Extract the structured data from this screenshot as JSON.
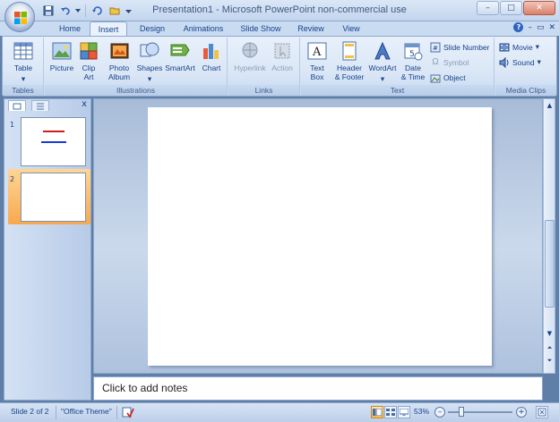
{
  "window": {
    "title": "Presentation1 - Microsoft PowerPoint non-commercial use",
    "controls": [
      "–",
      "□",
      "✕"
    ]
  },
  "tabs": [
    {
      "label": "Home",
      "active": false
    },
    {
      "label": "Insert",
      "active": true
    },
    {
      "label": "Design",
      "active": false
    },
    {
      "label": "Animations",
      "active": false
    },
    {
      "label": "Slide Show",
      "active": false
    },
    {
      "label": "Review",
      "active": false
    },
    {
      "label": "View",
      "active": false
    }
  ],
  "ribbon": {
    "groups": {
      "tables": "Tables",
      "illustrations": "Illustrations",
      "links": "Links",
      "text": "Text",
      "media": "Media Clips"
    },
    "buttons": {
      "table": "Table",
      "picture": "Picture",
      "clip_art_1": "Clip",
      "clip_art_2": "Art",
      "photo_album_1": "Photo",
      "photo_album_2": "Album",
      "shapes": "Shapes",
      "smartart": "SmartArt",
      "chart": "Chart",
      "hyperlink": "Hyperlink",
      "action": "Action",
      "text_box_1": "Text",
      "text_box_2": "Box",
      "header_footer_1": "Header",
      "header_footer_2": "& Footer",
      "wordart": "WordArt",
      "date_time_1": "Date",
      "date_time_2": "& Time",
      "slide_number": "Slide Number",
      "symbol": "Symbol",
      "object": "Object",
      "movie": "Movie",
      "sound": "Sound"
    }
  },
  "slides_panel": {
    "close": "x",
    "slides": [
      {
        "number": "1"
      },
      {
        "number": "2"
      }
    ]
  },
  "notes": {
    "placeholder": "Click to add notes"
  },
  "status": {
    "slide": "Slide 2 of 2",
    "theme": "\"Office Theme\"",
    "zoom": "53%",
    "zoom_minus": "–",
    "zoom_plus": "+"
  }
}
